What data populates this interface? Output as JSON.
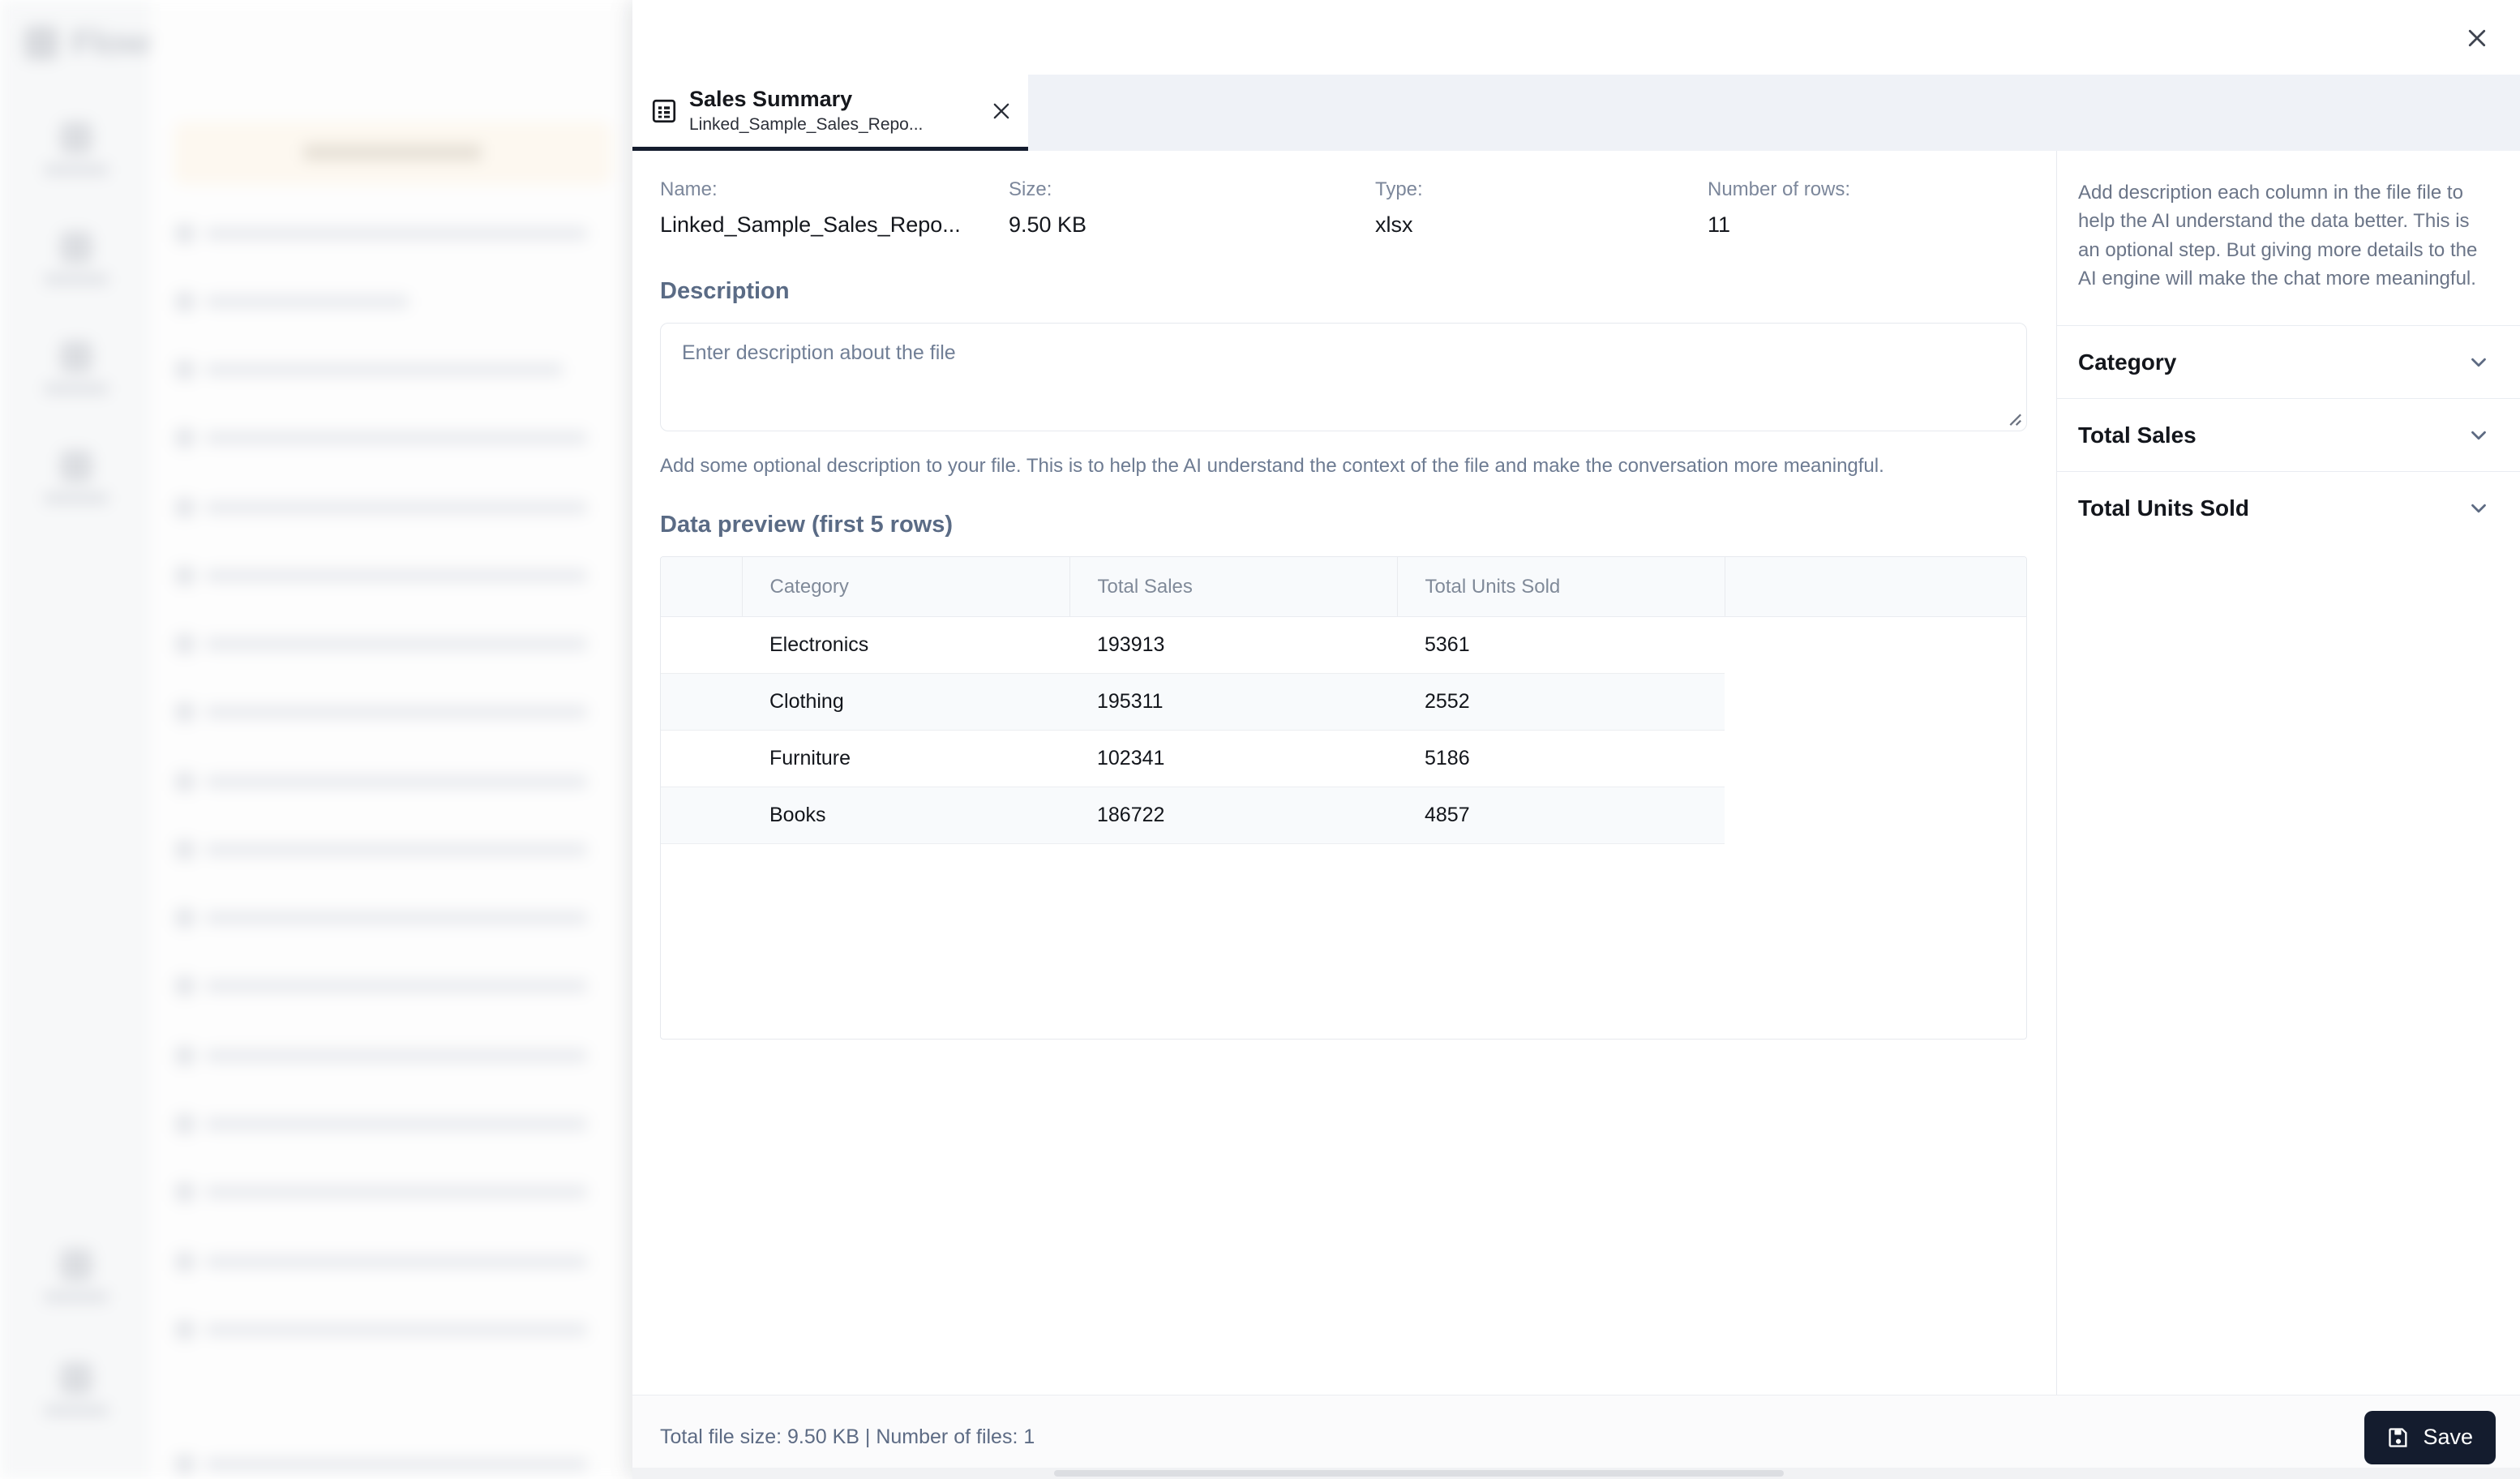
{
  "background": {
    "logo_text": "Flowtrail",
    "new_chat_label": "New Chat",
    "rail_items": [
      {
        "label": "Chats"
      },
      {
        "label": "Database"
      },
      {
        "label": "Queries"
      },
      {
        "label": "Settings"
      },
      {
        "label": "Alerts"
      },
      {
        "label": "Help"
      }
    ],
    "chat_items": [
      "Create a graph based on the cus...",
      "Give sales overview",
      "Give slots for profit margin cat...",
      "Create a graph based on the cus...",
      "Create a graph based on the cus...",
      "Create a graph based on the cus...",
      "Create a graph based on the cus...",
      "Create a graph based on the cus...",
      "Create a graph based on the cus...",
      "Create a graph based on the cus...",
      "Create a graph based on the cus...",
      "Create a graph based on the cus...",
      "Create a graph based on the cus...",
      "Create a graph based on the cus...",
      "Create a graph based on the cus..."
    ]
  },
  "tab": {
    "title": "Sales Summary",
    "subtitle": "Linked_Sample_Sales_Repo...",
    "icon": "spreadsheet-icon",
    "close_icon": "close-icon"
  },
  "meta": {
    "name_label": "Name:",
    "name_value": "Linked_Sample_Sales_Repo...",
    "size_label": "Size:",
    "size_value": "9.50 KB",
    "type_label": "Type:",
    "type_value": "xlsx",
    "rows_label": "Number of rows:",
    "rows_value": "11"
  },
  "description": {
    "heading": "Description",
    "placeholder": "Enter description about the file",
    "value": "",
    "help": "Add some optional description to your file. This is to help the AI understand the context of the file and make the conversation more meaningful."
  },
  "preview": {
    "heading": "Data preview (first 5 rows)",
    "columns": [
      "",
      "Category",
      "Total Sales",
      "Total Units Sold",
      ""
    ],
    "rows": [
      {
        "category": "Electronics",
        "total_sales": "193913",
        "total_units_sold": "5361"
      },
      {
        "category": "Clothing",
        "total_sales": "195311",
        "total_units_sold": "2552"
      },
      {
        "category": "Furniture",
        "total_sales": "102341",
        "total_units_sold": "5186"
      },
      {
        "category": "Books",
        "total_sales": "186722",
        "total_units_sold": "4857"
      }
    ]
  },
  "side_panel": {
    "help": "Add description each column in the file file to help the AI understand the data better. This is an optional step. But giving more details to the AI engine will make the chat more meaningful.",
    "accordions": [
      {
        "label": "Category"
      },
      {
        "label": "Total Sales"
      },
      {
        "label": "Total Units Sold"
      }
    ]
  },
  "footer": {
    "status": "Total file size: 9.50 KB | Number of files: 1",
    "save_label": "Save"
  },
  "colors": {
    "accent_dark": "#141c2e",
    "tab_strip": "#eff2f7",
    "muted_text": "#6d7b92"
  }
}
